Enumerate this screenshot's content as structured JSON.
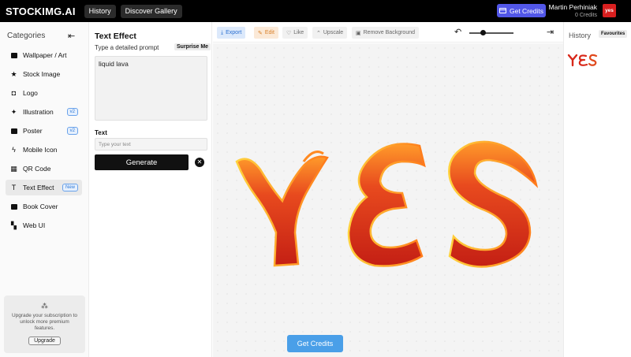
{
  "app": {
    "logo": "STOCKIMG.AI",
    "nav": [
      "History",
      "Discover Gallery"
    ],
    "get_credits": "Get Credits",
    "user_name": "Martin Perhiniak",
    "user_credits": "0 Credits",
    "avatar_text": "yes"
  },
  "sidebar": {
    "title": "Categories",
    "items": [
      {
        "label": "Wallpaper / Art",
        "icon": "image-icon"
      },
      {
        "label": "Stock Image",
        "icon": "star-icon"
      },
      {
        "label": "Logo",
        "icon": "logo-icon"
      },
      {
        "label": "Illustration",
        "icon": "sparkles-icon",
        "badge": "v2"
      },
      {
        "label": "Poster",
        "icon": "poster-icon",
        "badge": "v2"
      },
      {
        "label": "Mobile Icon",
        "icon": "lightning-icon"
      },
      {
        "label": "QR Code",
        "icon": "qr-icon"
      },
      {
        "label": "Text Effect",
        "icon": "text-icon",
        "badge": "New",
        "active": true
      },
      {
        "label": "Book Cover",
        "icon": "book-icon"
      },
      {
        "label": "Web UI",
        "icon": "grid-icon"
      }
    ],
    "upgrade_text": "Upgrade your subscription to unlock more premium features.",
    "upgrade_button": "Upgrade"
  },
  "panel": {
    "title": "Text Effect",
    "prompt_label": "Type a detailed prompt",
    "surprise_button": "Surprise Me",
    "prompt_value": "liquid lava",
    "text_label": "Text",
    "text_placeholder": "Type your text",
    "generate_button": "Generate"
  },
  "toolbar": {
    "export": "Export",
    "edit": "Edit",
    "like": "Like",
    "upscale": "Upscale",
    "remove_background": "Remove Background",
    "zoom_percent": 27
  },
  "canvas": {
    "generated_text": "YES",
    "get_credits_button": "Get Credits"
  },
  "history": {
    "title": "History",
    "favourites_button": "Favourites"
  },
  "colors": {
    "accent": "#5257e8",
    "lava_red": "#d8281a",
    "lava_orange": "#f08a24",
    "lava_yellow": "#ffcc33"
  }
}
